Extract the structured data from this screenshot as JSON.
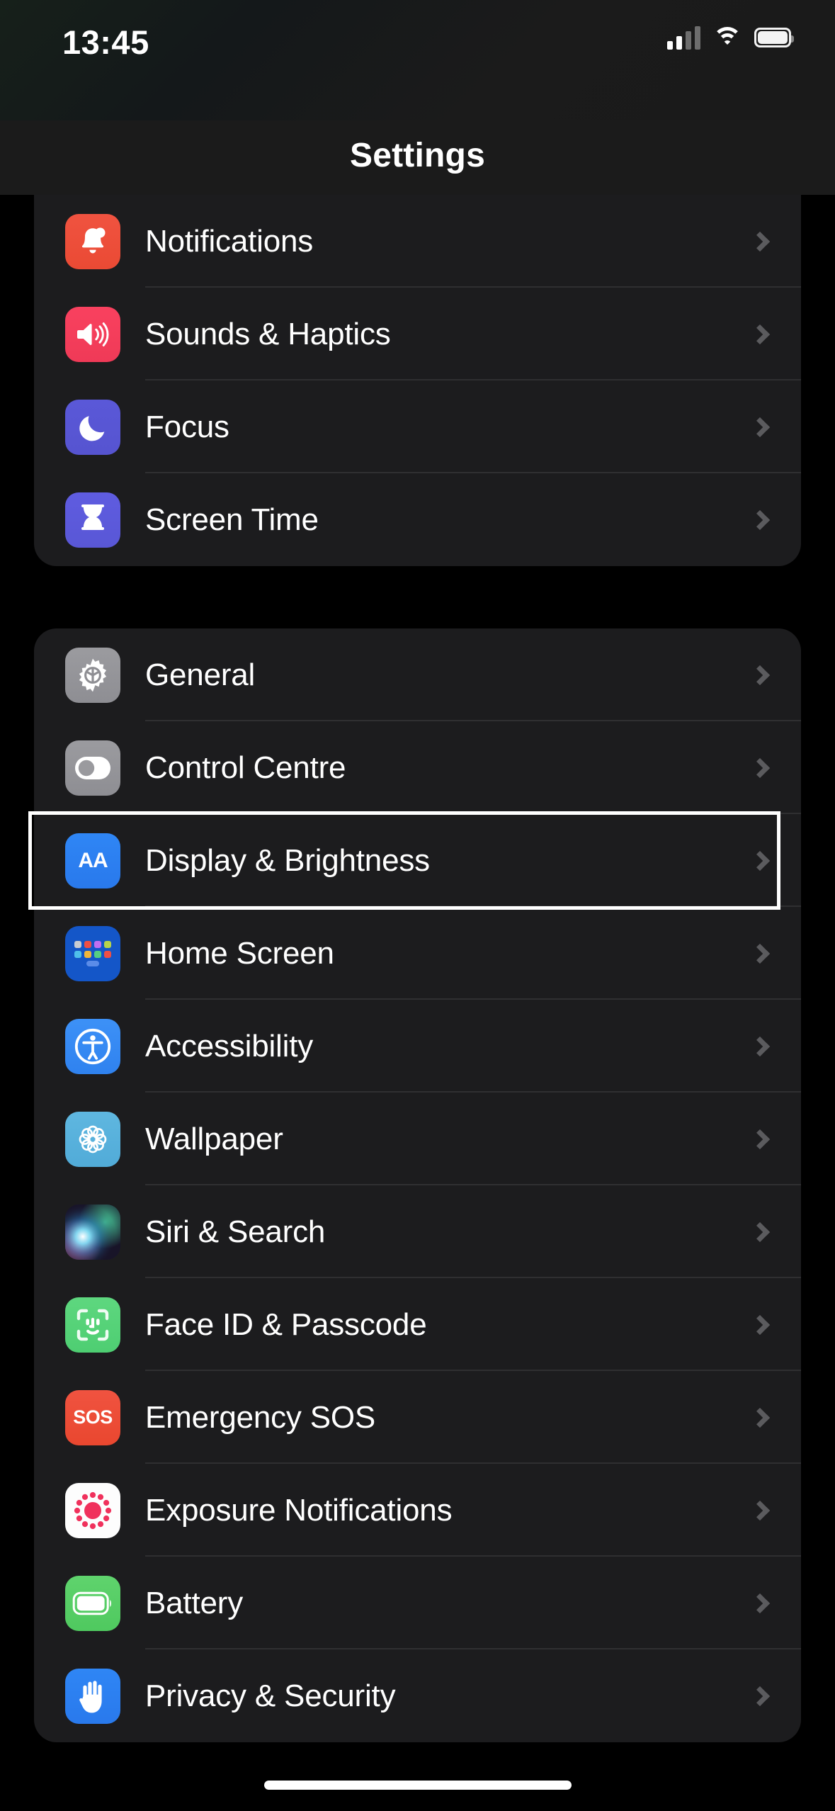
{
  "status_bar": {
    "time": "13:45",
    "cellular_icon": "cellular-signal-icon",
    "cellular_bars_filled": 2,
    "cellular_bars_total": 4,
    "wifi_icon": "wifi-icon",
    "battery_icon": "battery-full-icon"
  },
  "header": {
    "title": "Settings"
  },
  "groups": [
    {
      "id": "group-alerts",
      "clipped_top": true,
      "rows": [
        {
          "label": "Notifications",
          "icon": "bell-icon",
          "icon_class": "ic-notifications",
          "chevron": "chevron-right-icon"
        },
        {
          "label": "Sounds & Haptics",
          "icon": "speaker-waves-icon",
          "icon_class": "ic-sounds",
          "chevron": "chevron-right-icon"
        },
        {
          "label": "Focus",
          "icon": "crescent-moon-icon",
          "icon_class": "ic-focus",
          "chevron": "chevron-right-icon"
        },
        {
          "label": "Screen Time",
          "icon": "hourglass-icon",
          "icon_class": "ic-screentime",
          "chevron": "chevron-right-icon"
        }
      ]
    },
    {
      "id": "group-system",
      "clipped_top": false,
      "rows": [
        {
          "label": "General",
          "icon": "gear-icon",
          "icon_class": "ic-general",
          "chevron": "chevron-right-icon"
        },
        {
          "label": "Control Centre",
          "icon": "toggle-switch-icon",
          "icon_class": "ic-control",
          "chevron": "chevron-right-icon"
        },
        {
          "label": "Display & Brightness",
          "icon": "aa-text-size-icon",
          "icon_class": "ic-display",
          "chevron": "chevron-right-icon",
          "highlighted": true
        },
        {
          "label": "Home Screen",
          "icon": "app-grid-icon",
          "icon_class": "ic-home",
          "chevron": "chevron-right-icon"
        },
        {
          "label": "Accessibility",
          "icon": "accessibility-icon",
          "icon_class": "ic-accessibility",
          "chevron": "chevron-right-icon"
        },
        {
          "label": "Wallpaper",
          "icon": "flower-pattern-icon",
          "icon_class": "ic-wallpaper",
          "chevron": "chevron-right-icon"
        },
        {
          "label": "Siri & Search",
          "icon": "siri-orb-icon",
          "icon_class": "ic-siri",
          "chevron": "chevron-right-icon"
        },
        {
          "label": "Face ID & Passcode",
          "icon": "face-id-icon",
          "icon_class": "ic-faceid",
          "chevron": "chevron-right-icon"
        },
        {
          "label": "Emergency SOS",
          "icon": "sos-icon",
          "icon_class": "ic-sos",
          "chevron": "chevron-right-icon"
        },
        {
          "label": "Exposure Notifications",
          "icon": "exposure-dots-icon",
          "icon_class": "ic-exposure",
          "chevron": "chevron-right-icon"
        },
        {
          "label": "Battery",
          "icon": "battery-icon",
          "icon_class": "ic-battery",
          "chevron": "chevron-right-icon"
        },
        {
          "label": "Privacy & Security",
          "icon": "hand-raised-icon",
          "icon_class": "ic-privacy",
          "chevron": "chevron-right-icon"
        }
      ]
    }
  ],
  "selection": {
    "highlighted_row_label": "Display & Brightness",
    "highlight_color": "#ffffff"
  },
  "home_indicator": "home-indicator",
  "colors": {
    "background": "#000000",
    "card": "#1c1c1e",
    "separator": "#2f2f31",
    "label_text": "#ffffff",
    "chevron": "#5b5b5e",
    "navbar": "#1b1b1b"
  },
  "icon_art": {
    "sos_text": "SOS",
    "display_text": "AA"
  }
}
